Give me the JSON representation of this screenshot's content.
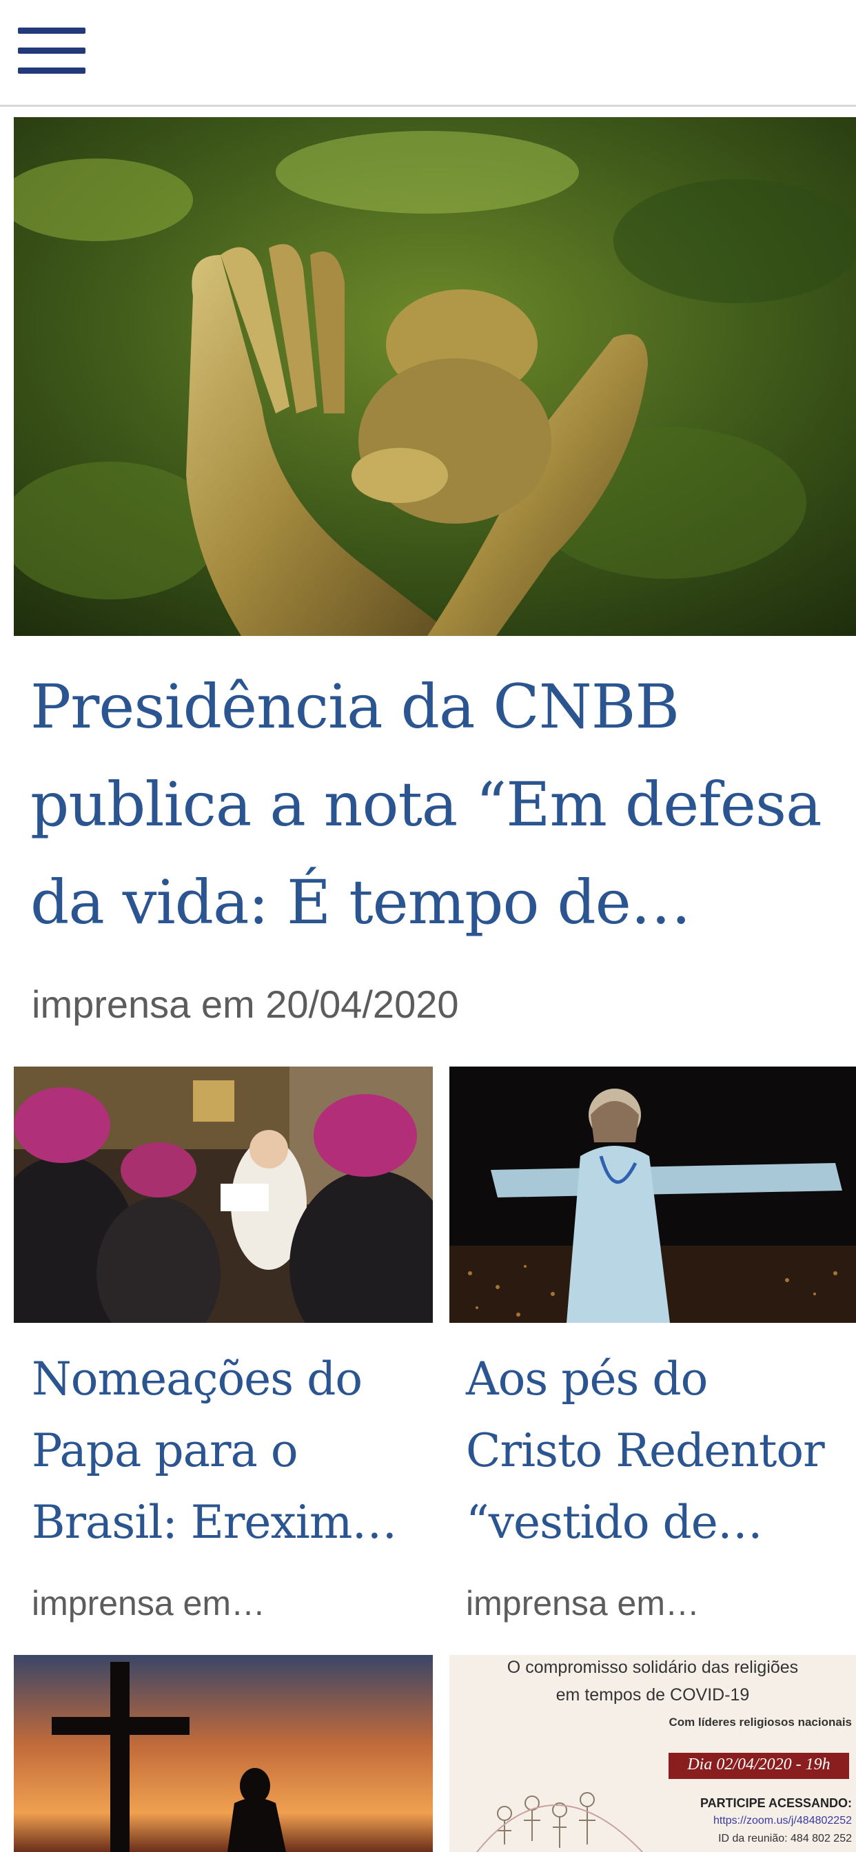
{
  "header": {
    "menu_icon": "hamburger-menu-icon"
  },
  "hero": {
    "title": "Presidência da CNBB publica a nota “Em defesa da vida: É tempo de…",
    "meta": "imprensa em 20/04/2020",
    "image_alt": "Golden sculpture of hands holding an infant"
  },
  "cards": [
    {
      "title": "Nomeações do Papa para o Brasil: Erexim…",
      "meta": "imprensa em…",
      "image_alt": "Pope reading to bishops"
    },
    {
      "title": "Aos pés do Cristo Redentor “vestido de…",
      "meta": "imprensa em…",
      "image_alt": "Christ the Redeemer statue illuminated at night"
    }
  ],
  "cards_bottom": [
    {
      "image_alt": "Cross silhouette at sunset"
    },
    {
      "image_alt": "Event poster",
      "poster": {
        "line1": "O compromisso solidário das religiões",
        "line2": "em tempos de COVID-19",
        "line3": "Com líderes religiosos nacionais",
        "date": "Dia 02/04/2020 - 19h",
        "cta": "PARTICIPE ACESSANDO:",
        "link": "https://zoom.us/j/484802252",
        "id": "ID da reunião: 484 802 252"
      }
    }
  ]
}
